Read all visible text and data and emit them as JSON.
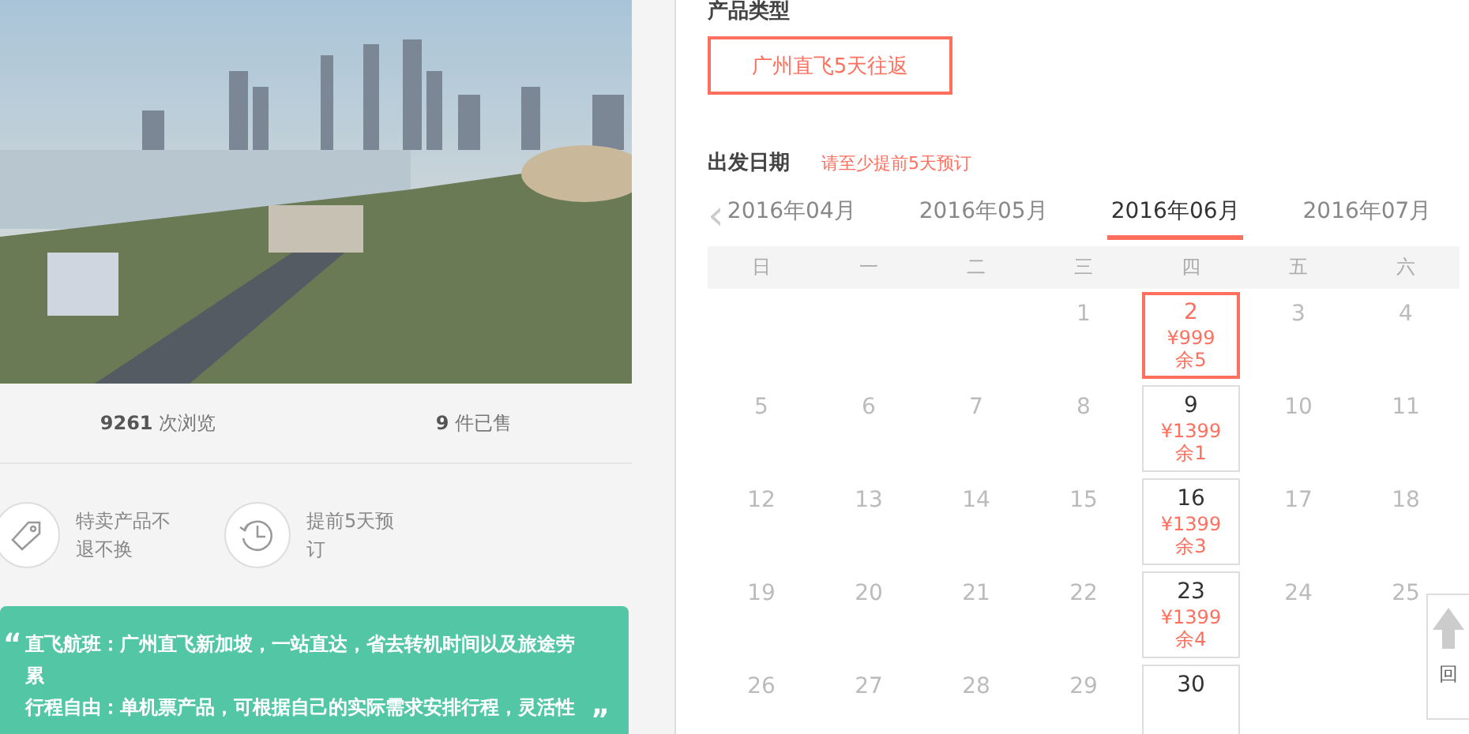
{
  "photo": {
    "kind": "city-skyline"
  },
  "stats": [
    {
      "text": "**9261** 次浏览"
    },
    {
      "text": "**9** 件已售"
    }
  ],
  "features": [
    {
      "kind": "tag",
      "text": "特卖产品不退不换"
    },
    {
      "kind": "clock",
      "text": "提前5天预订"
    }
  ],
  "highlights": {
    "open_quote": "“",
    "close_quote": "”",
    "items": [
      "直飞航班：广州直飞新加坡，一站直达，省去转机时间以及旅途劳累",
      "行程自由：单机票产品，可根据自己的实际需求安排行程，灵活性"
    ]
  },
  "product_type": {
    "label": "产品类型",
    "options": [
      {
        "label": "广州直飞5天往返",
        "selected": true
      }
    ]
  },
  "departure": {
    "label": "出发日期",
    "hint": "请至少提前5天预订"
  },
  "calendar": {
    "prev": "‹",
    "months": [
      {
        "label": "2016年04月",
        "selected": false
      },
      {
        "label": "2016年05月",
        "selected": false
      },
      {
        "label": "2016年06月",
        "selected": true
      },
      {
        "label": "2016年07月",
        "selected": false
      }
    ],
    "weekdays": [
      "日",
      "一",
      "二",
      "三",
      "四",
      "五",
      "六"
    ],
    "weeks": [
      [
        {
          "kind": "blank"
        },
        {
          "kind": "blank"
        },
        {
          "kind": "blank"
        },
        {
          "kind": "plain",
          "day": "1"
        },
        {
          "kind": "bookable",
          "day": "2",
          "price": "¥999",
          "remain": "余5",
          "selected": true
        },
        {
          "kind": "plain",
          "day": "3"
        },
        {
          "kind": "plain",
          "day": "4"
        }
      ],
      [
        {
          "kind": "plain",
          "day": "5"
        },
        {
          "kind": "plain",
          "day": "6"
        },
        {
          "kind": "plain",
          "day": "7"
        },
        {
          "kind": "plain",
          "day": "8"
        },
        {
          "kind": "bookable",
          "day": "9",
          "price": "¥1399",
          "remain": "余1",
          "selected": false
        },
        {
          "kind": "plain",
          "day": "10"
        },
        {
          "kind": "plain",
          "day": "11"
        }
      ],
      [
        {
          "kind": "plain",
          "day": "12"
        },
        {
          "kind": "plain",
          "day": "13"
        },
        {
          "kind": "plain",
          "day": "14"
        },
        {
          "kind": "plain",
          "day": "15"
        },
        {
          "kind": "bookable",
          "day": "16",
          "price": "¥1399",
          "remain": "余3",
          "selected": false
        },
        {
          "kind": "plain",
          "day": "17"
        },
        {
          "kind": "plain",
          "day": "18"
        }
      ],
      [
        {
          "kind": "plain",
          "day": "19"
        },
        {
          "kind": "plain",
          "day": "20"
        },
        {
          "kind": "plain",
          "day": "21"
        },
        {
          "kind": "plain",
          "day": "22"
        },
        {
          "kind": "bookable",
          "day": "23",
          "price": "¥1399",
          "remain": "余4",
          "selected": false
        },
        {
          "kind": "plain",
          "day": "24"
        },
        {
          "kind": "plain",
          "day": "25"
        }
      ],
      [
        {
          "kind": "plain",
          "day": "26"
        },
        {
          "kind": "plain",
          "day": "27"
        },
        {
          "kind": "plain",
          "day": "28"
        },
        {
          "kind": "plain",
          "day": "29"
        },
        {
          "kind": "bookable",
          "day": "30",
          "selected": false
        }
      ]
    ]
  },
  "back_to_top": {
    "label": "回"
  }
}
